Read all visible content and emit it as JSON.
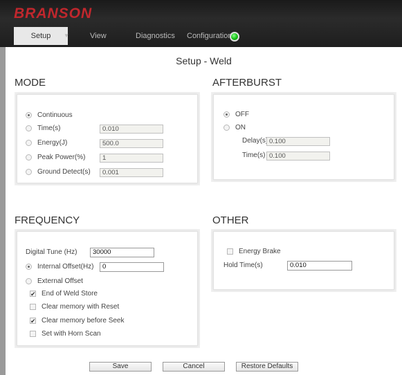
{
  "brand": "BRANSON",
  "nav": {
    "setup": "Setup",
    "view": "View",
    "diagnostics": "Diagnostics",
    "configuration": "Configuration",
    "caret": "▼"
  },
  "page_title": "Setup - Weld",
  "mode": {
    "title": "MODE",
    "options": [
      {
        "label": "Continuous",
        "value": "",
        "selected": true
      },
      {
        "label": "Time(s)",
        "value": "0.010",
        "selected": false
      },
      {
        "label": "Energy(J)",
        "value": "500.0",
        "selected": false
      },
      {
        "label": "Peak Power(%)",
        "value": "1",
        "selected": false
      },
      {
        "label": "Ground Detect(s)",
        "value": "0.001",
        "selected": false
      }
    ]
  },
  "afterburst": {
    "title": "AFTERBURST",
    "off_label": "OFF",
    "on_label": "ON",
    "delay_label": "Delay(s)",
    "delay_value": "0.100",
    "time_label": "Time(s)",
    "time_value": "0.100"
  },
  "frequency": {
    "title": "FREQUENCY",
    "digital_tune_label": "Digital Tune (Hz)",
    "digital_tune_value": "30000",
    "internal_offset_label": "Internal Offset(Hz)",
    "internal_offset_value": "0",
    "external_offset_label": "External Offset",
    "end_of_weld_store": "End of Weld Store",
    "clear_memory_reset": "Clear memory with Reset",
    "clear_memory_seek": "Clear memory before Seek",
    "set_with_horn_scan": "Set with Horn Scan"
  },
  "other": {
    "title": "OTHER",
    "energy_brake_label": "Energy Brake",
    "hold_time_label": "Hold Time(s)",
    "hold_time_value": "0.010"
  },
  "buttons": {
    "save": "Save",
    "cancel": "Cancel",
    "restore": "Restore Defaults"
  },
  "colors": {
    "brand": "#c0272d",
    "status_led": "#19c519"
  }
}
